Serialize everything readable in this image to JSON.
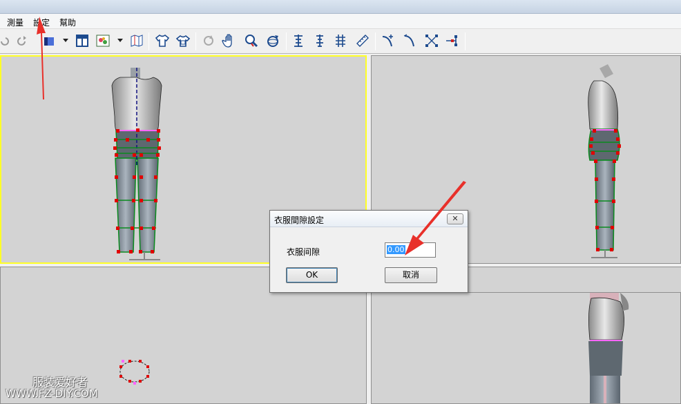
{
  "menu": {
    "items": [
      "測量",
      "設定",
      "幫助"
    ]
  },
  "toolbar": {
    "icons": [
      "undo-icon",
      "redo-icon",
      "color-fill-icon",
      "dropdown-arrow-icon",
      "layout-icon",
      "texture-icon",
      "dropdown-arrow-icon",
      "map-icon",
      "shirt-icon",
      "shirt-frame-icon",
      "rotate-icon",
      "hand-icon",
      "zoom-icon",
      "orbit-icon",
      "measure-front-icon",
      "measure-side-icon",
      "measure-grid-icon",
      "ruler-icon",
      "curve-left-icon",
      "curve-right-icon",
      "point-edit-icon",
      "point-add-icon"
    ]
  },
  "dialog": {
    "title": "衣服間隙設定",
    "close_symbol": "✕",
    "field_label": "衣服间隙",
    "field_value": "0.00",
    "ok_label": "OK",
    "cancel_label": "取消"
  },
  "watermark": {
    "name": "服装爱好者",
    "url": "WWW.FZ-DIY.COM"
  },
  "colors": {
    "viewport_bg": "#d3d3d3",
    "active_border": "#ffff26",
    "annotation_arrow": "#e8302a",
    "mesh_green": "#0a8a1e",
    "control_point": "#e00000",
    "waist_line": "#ff66ff"
  }
}
